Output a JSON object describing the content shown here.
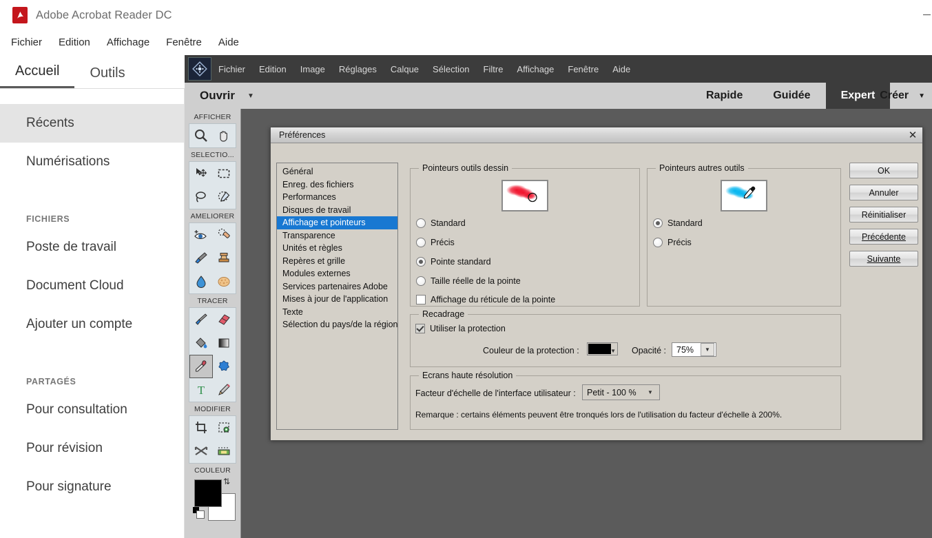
{
  "acrobat": {
    "title": "Adobe Acrobat Reader DC",
    "logo_icon": "acrobat-logo-icon",
    "minimize_label": "—",
    "menus": [
      "Fichier",
      "Edition",
      "Affichage",
      "Fenêtre",
      "Aide"
    ],
    "tabs": [
      {
        "label": "Accueil",
        "active": true
      },
      {
        "label": "Outils",
        "active": false
      }
    ],
    "sidebar": [
      {
        "type": "item",
        "label": "Récents",
        "selected": true
      },
      {
        "type": "item",
        "label": "Numérisations",
        "selected": false
      },
      {
        "type": "gap"
      },
      {
        "type": "head",
        "label": "FICHIERS"
      },
      {
        "type": "item",
        "label": "Poste de travail",
        "selected": false
      },
      {
        "type": "item",
        "label": "Document Cloud",
        "selected": false
      },
      {
        "type": "item",
        "label": "Ajouter un compte",
        "selected": false
      },
      {
        "type": "gap"
      },
      {
        "type": "head",
        "label": "PARTAGÉS"
      },
      {
        "type": "item",
        "label": "Pour consultation",
        "selected": false
      },
      {
        "type": "item",
        "label": "Pour révision",
        "selected": false
      },
      {
        "type": "item",
        "label": "Pour signature",
        "selected": false
      }
    ]
  },
  "photoshop": {
    "app_icon": "photoshop-elements-logo-icon",
    "menus": [
      "Fichier",
      "Edition",
      "Image",
      "Réglages",
      "Calque",
      "Sélection",
      "Filtre",
      "Affichage",
      "Fenêtre",
      "Aide"
    ],
    "open_label": "Ouvrir",
    "open_caret": "▼",
    "mode_tabs": [
      {
        "label": "Rapide",
        "active": false
      },
      {
        "label": "Guidée",
        "active": false
      },
      {
        "label": "Expert",
        "active": true
      }
    ],
    "create_label": "Créer",
    "create_caret": "▼",
    "toolbox": [
      {
        "label": "AFFICHER",
        "tools": [
          "zoom-icon",
          "hand-icon"
        ]
      },
      {
        "label": "SELECTIO...",
        "tools": [
          "move-icon",
          "rectangular-marquee-icon",
          "lasso-icon",
          "quick-selection-icon"
        ]
      },
      {
        "label": "AMELIORER",
        "tools": [
          "red-eye-removal-icon",
          "spot-healing-brush-icon",
          "smart-brush-icon",
          "clone-stamp-icon",
          "blur-icon",
          "sponge-icon"
        ]
      },
      {
        "label": "TRACER",
        "tools": [
          "brush-icon",
          "eraser-icon",
          "paint-bucket-icon",
          "gradient-icon",
          "eyedropper-icon",
          "custom-shape-icon",
          "type-icon",
          "pencil-icon"
        ]
      },
      {
        "label": "MODIFIER",
        "tools": [
          "crop-icon",
          "recompose-icon",
          "content-aware-move-icon",
          "straighten-icon"
        ]
      }
    ],
    "color_label": "COULEUR",
    "foreground_color": "#000000",
    "background_color": "#ffffff",
    "swap_icon": "swap-colors-icon"
  },
  "preferences": {
    "title": "Préférences",
    "close_icon": "close-icon",
    "categories": [
      {
        "label": "Général",
        "selected": false
      },
      {
        "label": "Enreg. des fichiers",
        "selected": false
      },
      {
        "label": "Performances",
        "selected": false
      },
      {
        "label": "Disques de travail",
        "selected": false
      },
      {
        "label": "Affichage et pointeurs",
        "selected": true
      },
      {
        "label": "Transparence",
        "selected": false
      },
      {
        "label": "Unités et règles",
        "selected": false
      },
      {
        "label": "Repères et grille",
        "selected": false
      },
      {
        "label": "Modules externes",
        "selected": false
      },
      {
        "label": "Services partenaires Adobe",
        "selected": false
      },
      {
        "label": "Mises à jour de l'application",
        "selected": false
      },
      {
        "label": "Texte",
        "selected": false
      },
      {
        "label": "Sélection du pays/de la région",
        "selected": false
      }
    ],
    "draw_group": {
      "legend": "Pointeurs outils dessin",
      "preview_icon": "red-brush-cursor-preview",
      "options": [
        {
          "label": "Standard",
          "selected": false
        },
        {
          "label": "Précis",
          "selected": false
        },
        {
          "label": "Pointe standard",
          "selected": true
        },
        {
          "label": "Taille réelle de la pointe",
          "selected": false
        }
      ],
      "checkbox": {
        "label": "Affichage du réticule de la pointe",
        "checked": false
      }
    },
    "other_group": {
      "legend": "Pointeurs autres outils",
      "preview_icon": "cyan-eyedropper-cursor-preview",
      "options": [
        {
          "label": "Standard",
          "selected": true
        },
        {
          "label": "Précis",
          "selected": false
        }
      ]
    },
    "crop_group": {
      "legend": "Recadrage",
      "checkbox": {
        "label": "Utiliser la protection",
        "checked": true
      },
      "color_label": "Couleur de la protection :",
      "color_value": "#000000",
      "opacity_label": "Opacité :",
      "opacity_value": "75%"
    },
    "hidpi_group": {
      "legend": "Ecrans haute résolution",
      "scale_label": "Facteur d'échelle de l'interface utilisateur :",
      "scale_value": "Petit - 100 %",
      "note": "Remarque : certains éléments peuvent être tronqués lors de l'utilisation du facteur d'échelle à 200%."
    },
    "buttons": [
      {
        "label": "OK",
        "underline_index": -1
      },
      {
        "label": "Annuler",
        "underline_index": -1
      },
      {
        "label": "Réinitialiser",
        "underline_index": -1
      },
      {
        "label": "Précédente",
        "underline_index": 0
      },
      {
        "label": "Suivante",
        "underline_index": 0
      }
    ]
  },
  "colors": {
    "selection_blue": "#1878d2",
    "dialog_gray": "#d4d0c8",
    "pse_dark": "#3c3c3c",
    "acrobat_red": "#c4161c"
  }
}
